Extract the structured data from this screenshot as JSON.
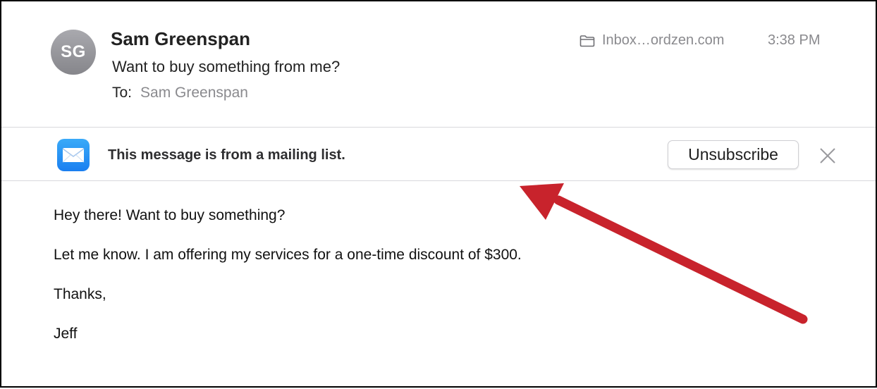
{
  "header": {
    "avatar_initials": "SG",
    "sender": "Sam Greenspan",
    "subject": "Want to buy something from me?",
    "to_label": "To:",
    "to_value": "Sam Greenspan",
    "mailbox": "Inbox…ordzen.com",
    "mailbox_icon": "folder-icon",
    "time": "3:38 PM"
  },
  "banner": {
    "app_icon": "mail-envelope-icon",
    "text": "This message is from a mailing list.",
    "unsubscribe_label": "Unsubscribe",
    "close_icon": "close-icon"
  },
  "body": {
    "lines": [
      "Hey there! Want to buy something?",
      "Let me know. I am offering my services for a one-time discount of $300.",
      "Thanks,",
      "Jeff"
    ]
  },
  "annotation": {
    "arrow_color": "#c8232c"
  },
  "colors": {
    "secondary_text": "#8a8a8e",
    "divider": "#d8d8dc",
    "mail_icon_blue": "#1a7ff0"
  }
}
